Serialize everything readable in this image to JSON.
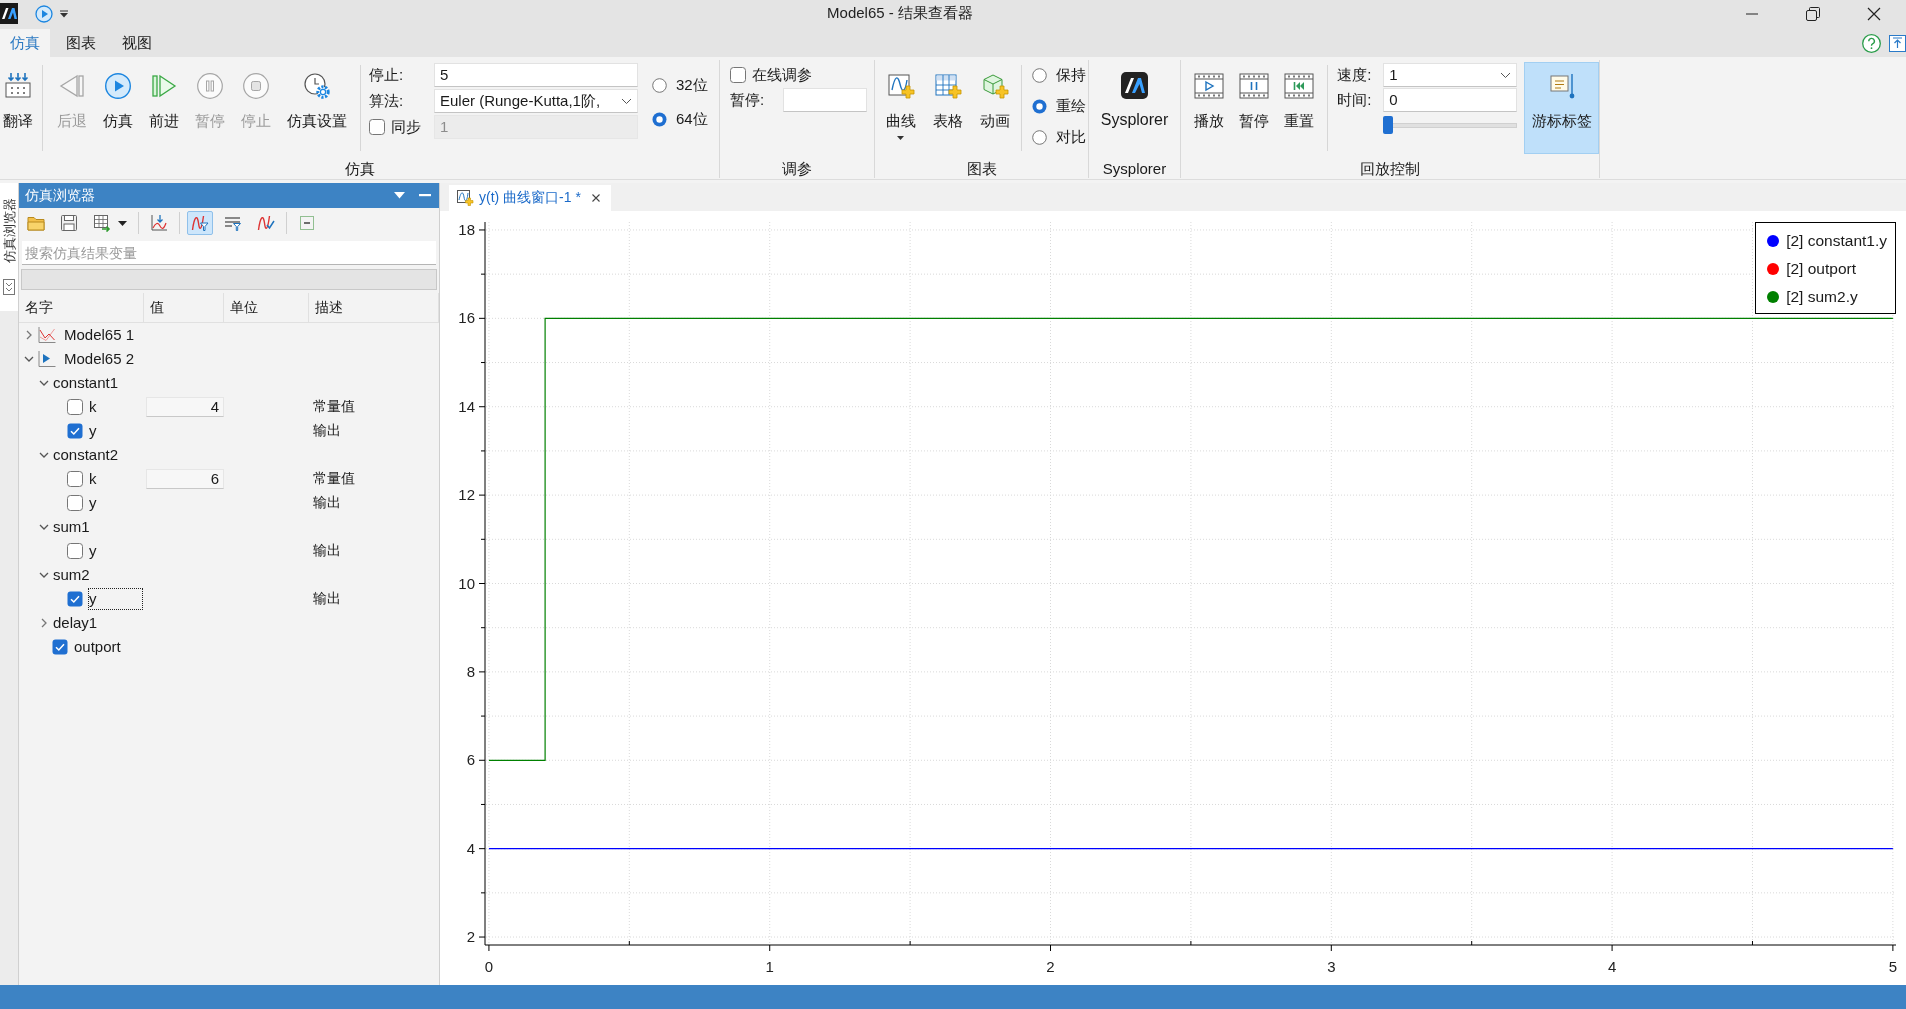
{
  "window": {
    "title": "Model65 - 结果查看器"
  },
  "ribbon_tabs": [
    {
      "label": "仿真",
      "selected": true
    },
    {
      "label": "图表",
      "selected": false
    },
    {
      "label": "视图",
      "selected": false
    }
  ],
  "ribbon": {
    "simulation": {
      "label": "仿真",
      "buttons": [
        {
          "label": "翻译",
          "kind": "translate",
          "disabled": false
        },
        {
          "label": "后退",
          "kind": "back",
          "disabled": true
        },
        {
          "label": "仿真",
          "kind": "run",
          "disabled": false
        },
        {
          "label": "前进",
          "kind": "forward",
          "disabled": false
        },
        {
          "label": "暂停",
          "kind": "pause",
          "disabled": true
        },
        {
          "label": "停止",
          "kind": "stop",
          "disabled": true
        },
        {
          "label": "仿真设置",
          "kind": "settings",
          "disabled": false
        }
      ],
      "stop_time": {
        "label": "停止:",
        "value": "5"
      },
      "algorithm": {
        "label": "算法:",
        "value": "Euler (Runge-Kutta,1阶,"
      },
      "sync": {
        "label": "同步",
        "checked": false,
        "value": "1"
      },
      "precision": [
        {
          "label": "32位",
          "selected": false
        },
        {
          "label": "64位",
          "selected": true
        }
      ]
    },
    "tuning": {
      "label": "调参",
      "online": {
        "label": "在线调参",
        "checked": false
      },
      "pause": {
        "label": "暂停:"
      }
    },
    "charts": {
      "label": "图表",
      "buttons": [
        {
          "label": "曲线",
          "kind": "curve",
          "has_menu": true
        },
        {
          "label": "表格",
          "kind": "table",
          "has_menu": false
        },
        {
          "label": "动画",
          "kind": "animation",
          "has_menu": false
        }
      ],
      "modes": [
        {
          "label": "保持",
          "selected": false
        },
        {
          "label": "重绘",
          "selected": true
        },
        {
          "label": "对比",
          "selected": false
        }
      ]
    },
    "sysplorer": {
      "label": "Sysplorer",
      "button": {
        "label": "Sysplorer"
      }
    },
    "playback": {
      "label": "回放控制",
      "buttons": [
        {
          "label": "播放",
          "kind": "play"
        },
        {
          "label": "暂停",
          "kind": "pause"
        },
        {
          "label": "重置",
          "kind": "reset"
        }
      ],
      "speed": {
        "label": "速度:",
        "value": "1"
      },
      "time": {
        "label": "时间:",
        "value": "0"
      },
      "time_slider": {
        "level": 0
      },
      "cursor_label": {
        "label": "游标标签",
        "on": true
      }
    }
  },
  "side_tabs": [
    {
      "label": "仿真浏览器"
    }
  ],
  "browser": {
    "title": "仿真浏览器",
    "toolbar": [
      {
        "kind": "open",
        "on": false
      },
      {
        "kind": "save",
        "on": false
      },
      {
        "kind": "export",
        "on": false
      },
      {
        "kind": "import",
        "on": false
      },
      {
        "kind": "curves",
        "on": true
      },
      {
        "kind": "list",
        "on": false
      },
      {
        "kind": "variables",
        "on": false
      },
      {
        "kind": "collapse",
        "on": false
      }
    ],
    "search": {
      "placeholder": "搜索仿真结果变量"
    },
    "columns": [
      "名字",
      "值",
      "单位",
      "描述"
    ],
    "tree": [
      {
        "label": "Model65 1",
        "kind": "result",
        "expanded": false,
        "selected": false
      },
      {
        "label": "Model65 2",
        "kind": "current",
        "expanded": true,
        "selected": false,
        "children": [
          {
            "label": "constant1",
            "kind": "component",
            "expanded": true,
            "selected": false,
            "children": [
              {
                "label": "k",
                "kind": "variable",
                "checked": false,
                "selected": false,
                "value": "4",
                "description": "常量值"
              },
              {
                "label": "y",
                "kind": "variable",
                "checked": true,
                "selected": false,
                "description": "输出"
              }
            ]
          },
          {
            "label": "constant2",
            "kind": "component",
            "expanded": true,
            "selected": false,
            "children": [
              {
                "label": "k",
                "kind": "variable",
                "checked": false,
                "selected": false,
                "value": "6",
                "description": "常量值"
              },
              {
                "label": "y",
                "kind": "variable",
                "checked": false,
                "selected": false,
                "description": "输出"
              }
            ]
          },
          {
            "label": "sum1",
            "kind": "component",
            "expanded": true,
            "selected": false,
            "children": [
              {
                "label": "y",
                "kind": "variable",
                "checked": false,
                "selected": false,
                "description": "输出"
              }
            ]
          },
          {
            "label": "sum2",
            "kind": "component",
            "expanded": true,
            "selected": false,
            "children": [
              {
                "label": "y",
                "kind": "variable",
                "checked": true,
                "selected": true,
                "description": "输出"
              }
            ]
          },
          {
            "label": "delay1",
            "kind": "component",
            "expanded": false,
            "selected": false
          },
          {
            "label": "outport",
            "kind": "variable",
            "checked": true,
            "selected": false
          }
        ]
      }
    ]
  },
  "plot": {
    "tabs": [
      {
        "label": "y(t) 曲线窗口-1 *",
        "selected": true
      }
    ],
    "chart_data": {
      "type": "line",
      "x": [
        0,
        0.2,
        0.2,
        5
      ],
      "series": [
        {
          "name": "[2] constant1.y",
          "color": "#0000ff",
          "values": [
            4,
            4,
            4,
            4
          ]
        },
        {
          "name": "[2] outport",
          "color": "#ff0000",
          "values": [
            null,
            null,
            null,
            null
          ]
        },
        {
          "name": "[2] sum2.y",
          "color": "#008000",
          "values": [
            6,
            6,
            16,
            16
          ]
        }
      ],
      "xlim": [
        -0.014,
        5.004
      ],
      "ylim": [
        1.82,
        18.18
      ],
      "xticks": [
        {
          "value": 0,
          "label": "0"
        },
        {
          "value": 1,
          "label": "1"
        },
        {
          "value": 2,
          "label": "2"
        },
        {
          "value": 3,
          "label": "3"
        },
        {
          "value": 4,
          "label": "4"
        },
        {
          "value": 5,
          "label": "5"
        }
      ],
      "yticks": [
        {
          "value": 2,
          "label": "2"
        },
        {
          "value": 4,
          "label": "4"
        },
        {
          "value": 6,
          "label": "6"
        },
        {
          "value": 8,
          "label": "8"
        },
        {
          "value": 10,
          "label": "10"
        },
        {
          "value": 12,
          "label": "12"
        },
        {
          "value": 14,
          "label": "14"
        },
        {
          "value": 16,
          "label": "16"
        },
        {
          "value": 18,
          "label": "18"
        }
      ],
      "grid": true,
      "legend": "upper right"
    }
  }
}
